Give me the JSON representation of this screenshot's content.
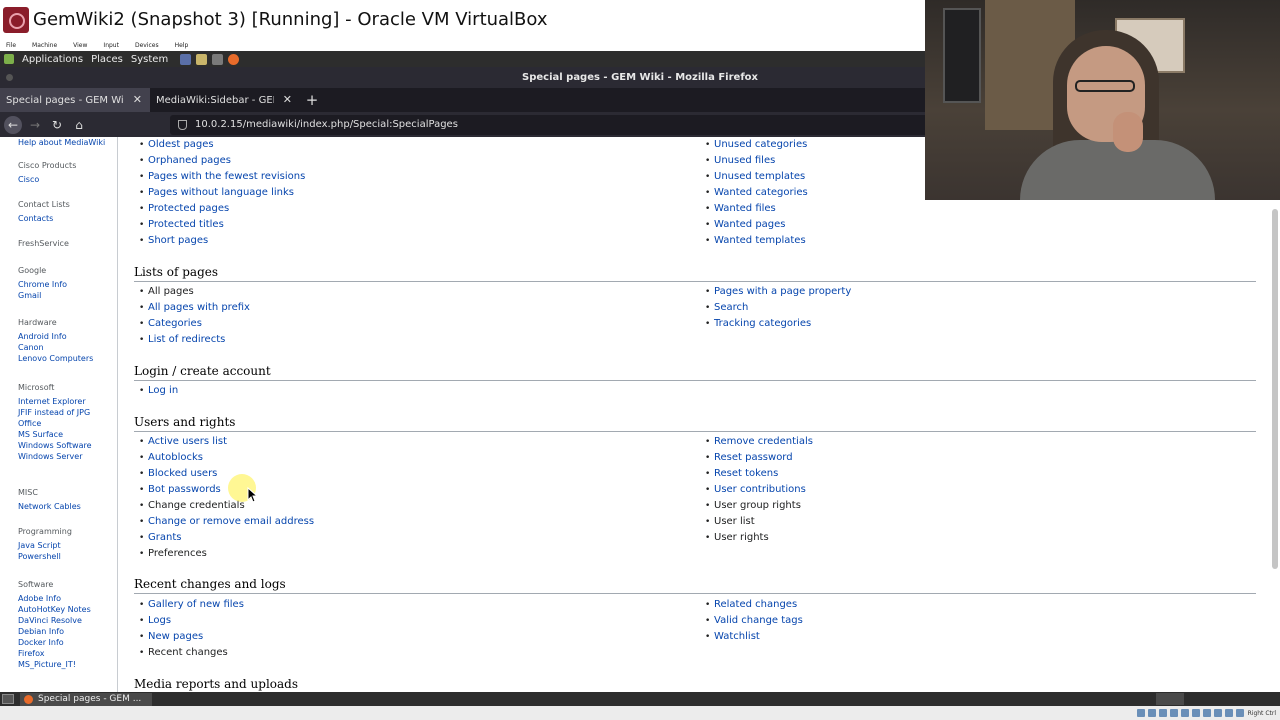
{
  "vbox": {
    "title": "GemWiki2 (Snapshot 3) [Running] - Oracle VM VirtualBox",
    "menu": [
      "File",
      "Machine",
      "View",
      "Input",
      "Devices",
      "Help"
    ],
    "host_key": "Right Ctrl"
  },
  "gnome_panel": {
    "items": [
      "Applications",
      "Places",
      "System"
    ]
  },
  "firefox": {
    "window_title": "Special pages - GEM Wiki - Mozilla Firefox",
    "tabs": [
      {
        "label": "Special pages - GEM Wiki",
        "active": true
      },
      {
        "label": "MediaWiki:Sidebar - GEM W",
        "active": false
      }
    ],
    "url": "10.0.2.15/mediawiki/index.php/Special:SpecialPages"
  },
  "sidebar": {
    "groups": [
      {
        "heading": "",
        "links": [
          "Help about MediaWiki"
        ]
      },
      {
        "heading": "Cisco Products",
        "links": [
          "Cisco"
        ]
      },
      {
        "heading": "Contact Lists",
        "links": [
          "Contacts"
        ]
      },
      {
        "heading": "FreshService",
        "links": []
      },
      {
        "heading": "Google",
        "links": [
          "Chrome Info",
          "Gmail"
        ]
      },
      {
        "heading": "Hardware",
        "links": [
          "Android Info",
          "Canon",
          "Lenovo Computers"
        ]
      },
      {
        "heading": "Microsoft",
        "links": [
          "Internet Explorer",
          "JFIF instead of JPG",
          "Office",
          "MS Surface",
          "Windows Software",
          "Windows Server"
        ]
      },
      {
        "heading": "MISC",
        "links": [
          "Network Cables"
        ]
      },
      {
        "heading": "Programming",
        "links": [
          "Java Script",
          "Powershell"
        ]
      },
      {
        "heading": "Software",
        "links": [
          "Adobe Info",
          "AutoHotKey Notes",
          "DaVinci Resolve",
          "Debian Info",
          "Docker Info",
          "Firefox",
          "MS_Picture_IT!"
        ]
      }
    ]
  },
  "sections": {
    "maintenance": {
      "left": [
        "Oldest pages",
        "Orphaned pages",
        "Pages with the fewest revisions",
        "Pages without language links",
        "Protected pages",
        "Protected titles",
        "Short pages"
      ],
      "right": [
        "Unused categories",
        "Unused files",
        "Unused templates",
        "Wanted categories",
        "Wanted files",
        "Wanted pages",
        "Wanted templates"
      ]
    },
    "lists": {
      "heading": "Lists of pages",
      "left": [
        "All pages",
        "All pages with prefix",
        "Categories",
        "List of redirects"
      ],
      "right": [
        "Pages with a page property",
        "Search",
        "Tracking categories"
      ]
    },
    "login": {
      "heading": "Login / create account",
      "left": [
        "Log in"
      ]
    },
    "users": {
      "heading": "Users and rights",
      "left": [
        "Active users list",
        "Autoblocks",
        "Blocked users",
        "Bot passwords",
        "Change credentials",
        "Change or remove email address",
        "Grants",
        "Preferences"
      ],
      "right": [
        "Remove credentials",
        "Reset password",
        "Reset tokens",
        "User contributions",
        "User group rights",
        "User list",
        "User rights"
      ]
    },
    "recent": {
      "heading": "Recent changes and logs",
      "left": [
        "Gallery of new files",
        "Logs",
        "New pages",
        "Recent changes"
      ],
      "right": [
        "Related changes",
        "Valid change tags",
        "Watchlist"
      ]
    },
    "media": {
      "heading": "Media reports and uploads"
    }
  },
  "taskbar": {
    "task_label": "Special pages - GEM ..."
  }
}
